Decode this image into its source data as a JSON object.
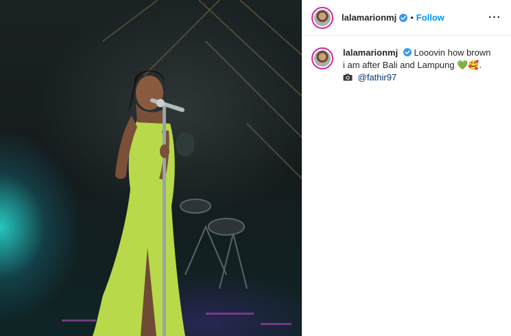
{
  "post": {
    "username": "lalamarionmj",
    "follow_label": "Follow",
    "separator": "•",
    "more_label": "···",
    "caption": {
      "text_line1": "Looovin how brown i",
      "text_line2": "am after Bali and Lampung",
      "emoji": "💚🥰.",
      "mention": "@fathir97"
    }
  },
  "icons": {
    "verified": "verified-badge-icon",
    "camera": "camera-icon",
    "more": "more-options-icon"
  },
  "colors": {
    "accent": "#0095f6",
    "verified_blue": "#3897f0",
    "dress": "#b8d94a"
  }
}
